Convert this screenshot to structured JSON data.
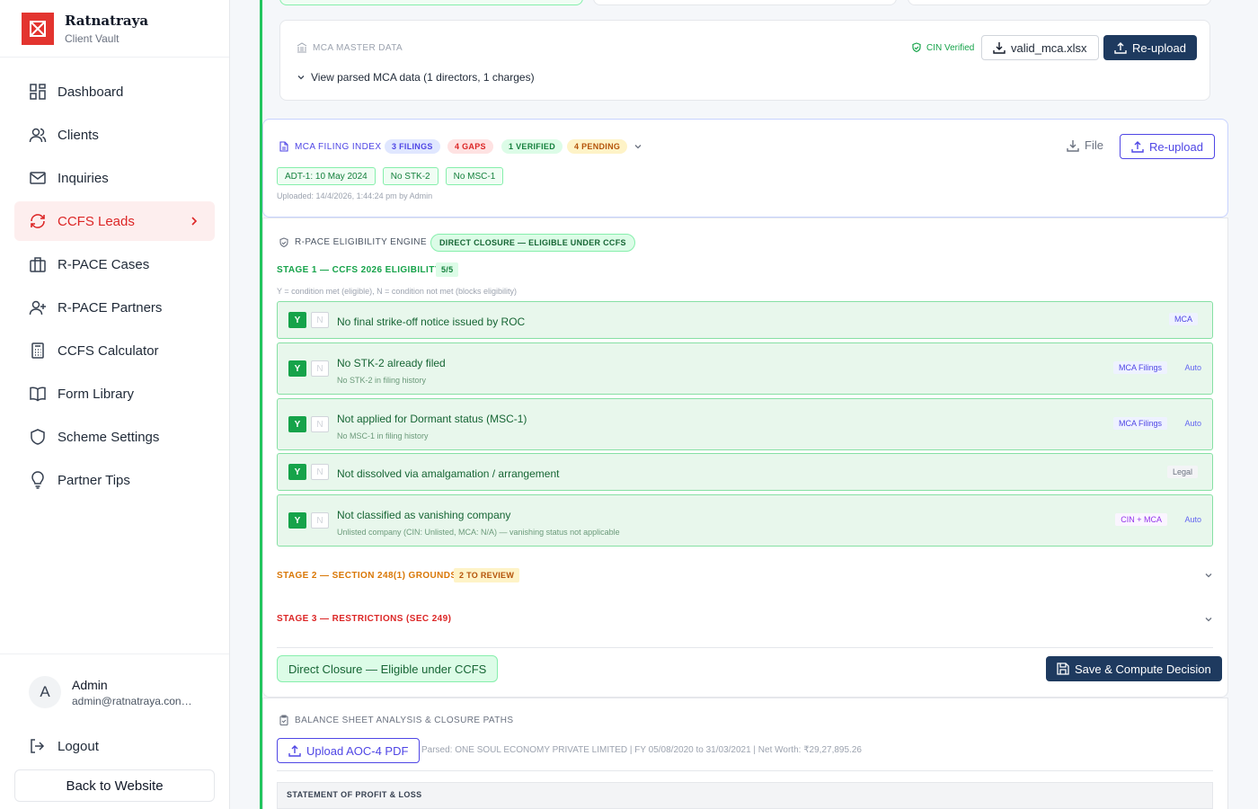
{
  "brand": {
    "name": "Ratnatraya",
    "subtitle": "Client Vault"
  },
  "nav": [
    {
      "label": "Dashboard",
      "icon": "dashboard-icon"
    },
    {
      "label": "Clients",
      "icon": "users-icon"
    },
    {
      "label": "Inquiries",
      "icon": "mail-icon"
    },
    {
      "label": "CCFS Leads",
      "icon": "refresh-icon",
      "active": true
    },
    {
      "label": "R-PACE Cases",
      "icon": "briefcase-icon"
    },
    {
      "label": "R-PACE Partners",
      "icon": "user-plus-icon"
    },
    {
      "label": "CCFS Calculator",
      "icon": "calculator-icon"
    },
    {
      "label": "Form Library",
      "icon": "book-icon"
    },
    {
      "label": "Scheme Settings",
      "icon": "shield-icon"
    },
    {
      "label": "Partner Tips",
      "icon": "lightbulb-icon"
    }
  ],
  "user": {
    "initial": "A",
    "name": "Admin",
    "email": "admin@ratnatraya.con…"
  },
  "logout_label": "Logout",
  "back_label": "Back to Website",
  "mca_master": {
    "title": "MCA MASTER DATA",
    "verified": "CIN Verified",
    "file": "valid_mca.xlsx",
    "reupload": "Re-upload",
    "toggle": "View parsed MCA data (1 directors, 1 charges)"
  },
  "filing_index": {
    "title": "MCA FILING INDEX",
    "badges": {
      "filings": "3 FILINGS",
      "gaps": "4 GAPS",
      "verified": "1 VERIFIED",
      "pending": "4 PENDING"
    },
    "file_label": "File",
    "reupload": "Re-upload",
    "tags": [
      "ADT-1: 10 May 2024",
      "No STK-2",
      "No MSC-1"
    ],
    "uploaded": "Uploaded: 14/4/2026, 1:44:24 pm by Admin"
  },
  "engine": {
    "title": "R-PACE ELIGIBILITY ENGINE",
    "result_badge": "DIRECT CLOSURE — ELIGIBLE UNDER CCFS",
    "stage1": {
      "title": "STAGE 1 — CCFS 2026 ELIGIBILITY",
      "score": "5/5"
    },
    "legend": "Y = condition met (eligible), N = condition not met (blocks eligibility)",
    "yes": "Y",
    "no": "N",
    "conditions": [
      {
        "title": "No final strike-off notice issued by ROC",
        "sub": "",
        "source": "MCA",
        "auto": ""
      },
      {
        "title": "No STK-2 already filed",
        "sub": "No STK-2 in filing history",
        "source": "MCA Filings",
        "auto": "Auto"
      },
      {
        "title": "Not applied for Dormant status (MSC-1)",
        "sub": "No MSC-1 in filing history",
        "source": "MCA Filings",
        "auto": "Auto"
      },
      {
        "title": "Not dissolved via amalgamation / arrangement",
        "sub": "",
        "source": "Legal",
        "auto": ""
      },
      {
        "title": "Not classified as vanishing company",
        "sub": "Unlisted company (CIN: Unlisted, MCA: N/A) — vanishing status not applicable",
        "source": "CIN + MCA",
        "auto": "Auto"
      }
    ],
    "stage2": {
      "title": "STAGE 2 — SECTION 248(1) GROUNDS",
      "badge": "2 TO REVIEW"
    },
    "stage3": {
      "title": "STAGE 3 — RESTRICTIONS (SEC 249)"
    },
    "decision": "Direct Closure — Eligible under CCFS",
    "save": "Save & Compute Decision"
  },
  "balance": {
    "title": "BALANCE SHEET ANALYSIS & CLOSURE PATHS",
    "upload": "Upload AOC-4 PDF",
    "parsed": "Parsed: ONE SOUL ECONOMY PRIVATE LIMITED | FY 05/08/2020 to 31/03/2021 | Net Worth: ₹29,27,895.26",
    "table_header": "STATEMENT OF PROFIT & LOSS"
  },
  "colors": {
    "accent": "#dc2626",
    "success": "#16a34a",
    "navy": "#1e3a5f",
    "warning": "#d97706",
    "indigo": "#4f46e5"
  }
}
